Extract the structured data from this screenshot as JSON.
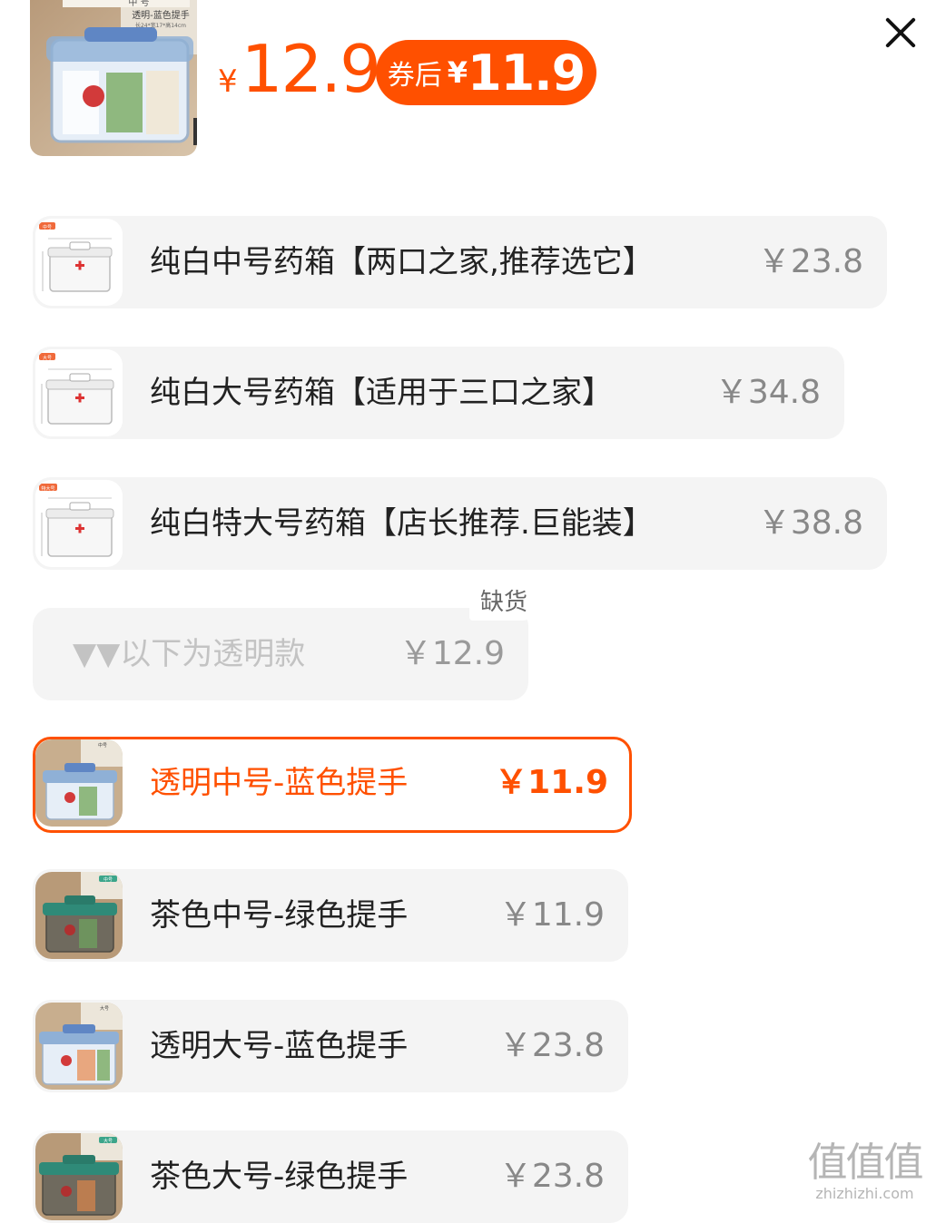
{
  "header": {
    "currency": "¥",
    "current_price": "12.9",
    "coupon_label": "券后",
    "coupon_currency": "¥",
    "coupon_price": "11.9",
    "thumb_caption_1": "中 号",
    "thumb_caption_2": "透明-蓝色提手",
    "thumb_caption_3": "长24*宽17*高14cm",
    "close_icon": "close-icon"
  },
  "options": [
    {
      "name": "纯白中号药箱【两口之家,推荐选它】",
      "price": "￥23.8",
      "thumb_tag": "中号",
      "state": "normal"
    },
    {
      "name": "纯白大号药箱【适用于三口之家】",
      "price": "￥34.8",
      "thumb_tag": "大号",
      "state": "normal"
    },
    {
      "name": "纯白特大号药箱【店长推荐.巨能装】",
      "price": "￥38.8",
      "thumb_tag": "特大号",
      "state": "normal"
    },
    {
      "name": "▼▼以下为透明款",
      "price": "￥12.9",
      "state": "disabled",
      "stock_tag": "缺货"
    },
    {
      "name": "透明中号-蓝色提手",
      "price": "￥11.9",
      "thumb_tag": "中号",
      "state": "selected"
    },
    {
      "name": "茶色中号-绿色提手",
      "price": "￥11.9",
      "thumb_tag": "中号",
      "state": "normal"
    },
    {
      "name": "透明大号-蓝色提手",
      "price": "￥23.8",
      "thumb_tag": "大号",
      "state": "normal"
    },
    {
      "name": "茶色大号-绿色提手",
      "price": "￥23.8",
      "thumb_tag": "大号",
      "state": "normal"
    }
  ],
  "watermark": {
    "big": "值值值",
    "small": "zhizhizhi.com"
  },
  "colors": {
    "accent": "#ff5000",
    "option_bg": "#f4f4f4",
    "price_gray": "#888888"
  }
}
